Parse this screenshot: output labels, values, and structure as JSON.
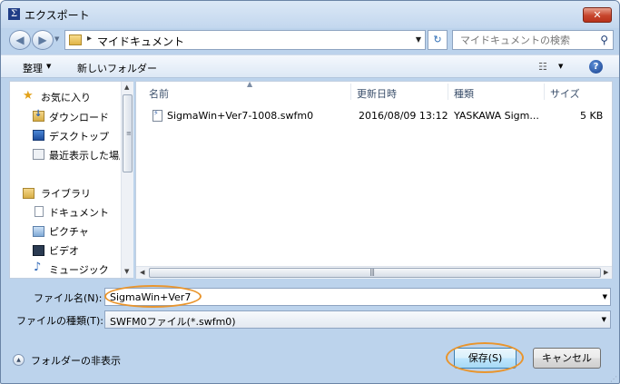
{
  "window": {
    "title": "エクスポート",
    "app_icon": "Σ",
    "close_glyph": "✕"
  },
  "address": {
    "crumb_separator": "▸",
    "current_folder": "マイドキュメント",
    "search_placeholder": "マイドキュメントの検索"
  },
  "toolbar": {
    "organize_label": "整理",
    "new_folder_label": "新しいフォルダー",
    "help_glyph": "?"
  },
  "nav_pane": {
    "items": [
      {
        "label": "お気に入り",
        "icon": "star-icon"
      },
      {
        "label": "ダウンロード",
        "icon": "downloads-folder-icon"
      },
      {
        "label": "デスクトップ",
        "icon": "desktop-icon"
      },
      {
        "label": "最近表示した場所",
        "icon": "recent-places-icon"
      },
      {
        "label": "ライブラリ",
        "icon": "libraries-icon"
      },
      {
        "label": "ドキュメント",
        "icon": "documents-icon"
      },
      {
        "label": "ピクチャ",
        "icon": "pictures-icon"
      },
      {
        "label": "ビデオ",
        "icon": "videos-icon"
      },
      {
        "label": "ミュージック",
        "icon": "music-icon"
      }
    ]
  },
  "file_list": {
    "columns": [
      "名前",
      "更新日時",
      "種類",
      "サイズ"
    ],
    "rows": [
      {
        "name": "SigmaWin+Ver7-1008.swfm0",
        "modified": "2016/08/09 13:12",
        "type": "YASKAWA Sigm...",
        "size": "5 KB"
      }
    ]
  },
  "form": {
    "file_name_label": "ファイル名(N):",
    "file_name_value": "SigmaWin+Ver7",
    "file_type_label": "ファイルの種類(T):",
    "file_type_value": "SWFM0ファイル(*.swfm0)"
  },
  "footer": {
    "hide_folders_label": "フォルダーの非表示",
    "save_label": "保存(S)",
    "cancel_label": "キャンセル"
  },
  "colors": {
    "highlight_ring": "#e9952d",
    "window_frame": "#bcd3ec"
  }
}
